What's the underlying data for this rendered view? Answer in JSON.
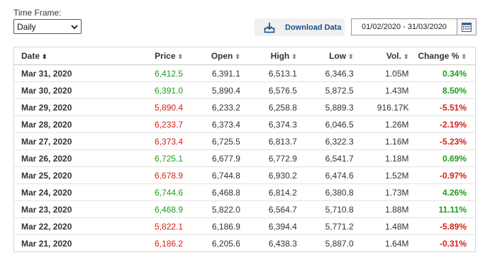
{
  "time_frame": {
    "label": "Time Frame:",
    "selected": "Daily"
  },
  "download": {
    "label": "Download Data"
  },
  "date_range": {
    "value": "01/02/2020 - 31/03/2020"
  },
  "colors": {
    "up": "#1e9e1e",
    "down": "#d91e18",
    "link": "#1a4d8a"
  },
  "table": {
    "headers": {
      "date": "Date",
      "price": "Price",
      "open": "Open",
      "high": "High",
      "low": "Low",
      "vol": "Vol.",
      "change": "Change %"
    },
    "rows": [
      {
        "date": "Mar 31, 2020",
        "price": "6,412.5",
        "open": "6,391.1",
        "high": "6,513.1",
        "low": "6,346.3",
        "vol": "1.05M",
        "change": "0.34%",
        "dir": "up"
      },
      {
        "date": "Mar 30, 2020",
        "price": "6,391.0",
        "open": "5,890.4",
        "high": "6,576.5",
        "low": "5,872.5",
        "vol": "1.43M",
        "change": "8.50%",
        "dir": "up"
      },
      {
        "date": "Mar 29, 2020",
        "price": "5,890.4",
        "open": "6,233.2",
        "high": "6,258.8",
        "low": "5,889.3",
        "vol": "916.17K",
        "change": "-5.51%",
        "dir": "down"
      },
      {
        "date": "Mar 28, 2020",
        "price": "6,233.7",
        "open": "6,373.4",
        "high": "6,374.3",
        "low": "6,046.5",
        "vol": "1.26M",
        "change": "-2.19%",
        "dir": "down"
      },
      {
        "date": "Mar 27, 2020",
        "price": "6,373.4",
        "open": "6,725.5",
        "high": "6,813.7",
        "low": "6,322.3",
        "vol": "1.16M",
        "change": "-5.23%",
        "dir": "down"
      },
      {
        "date": "Mar 26, 2020",
        "price": "6,725.1",
        "open": "6,677.9",
        "high": "6,772.9",
        "low": "6,541.7",
        "vol": "1.18M",
        "change": "0.69%",
        "dir": "up"
      },
      {
        "date": "Mar 25, 2020",
        "price": "6,678.9",
        "open": "6,744.8",
        "high": "6,930.2",
        "low": "6,474.6",
        "vol": "1.52M",
        "change": "-0.97%",
        "dir": "down"
      },
      {
        "date": "Mar 24, 2020",
        "price": "6,744.6",
        "open": "6,468.8",
        "high": "6,814.2",
        "low": "6,380.8",
        "vol": "1.73M",
        "change": "4.26%",
        "dir": "up"
      },
      {
        "date": "Mar 23, 2020",
        "price": "6,468.9",
        "open": "5,822.0",
        "high": "6,564.7",
        "low": "5,710.8",
        "vol": "1.88M",
        "change": "11.11%",
        "dir": "up"
      },
      {
        "date": "Mar 22, 2020",
        "price": "5,822.1",
        "open": "6,186.9",
        "high": "6,394.4",
        "low": "5,771.2",
        "vol": "1.48M",
        "change": "-5.89%",
        "dir": "down"
      },
      {
        "date": "Mar 21, 2020",
        "price": "6,186.2",
        "open": "6,205.6",
        "high": "6,438.3",
        "low": "5,887.0",
        "vol": "1.64M",
        "change": "-0.31%",
        "dir": "down"
      }
    ]
  }
}
